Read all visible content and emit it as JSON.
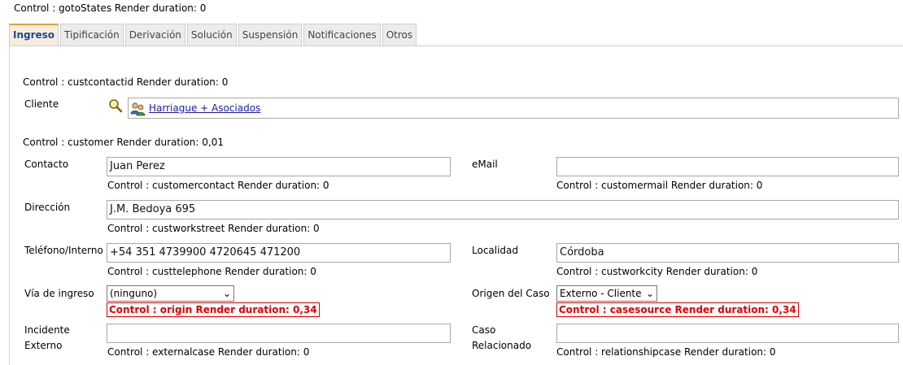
{
  "header": {
    "render_text": "Control : gotoStates Render duration: 0"
  },
  "tabs": [
    {
      "label": "Ingreso"
    },
    {
      "label": "Tipificación"
    },
    {
      "label": "Derivación"
    },
    {
      "label": "Solución"
    },
    {
      "label": "Suspensión"
    },
    {
      "label": "Notificaciones"
    },
    {
      "label": "Otros"
    }
  ],
  "form": {
    "custcontactid_render": "Control : custcontactid Render duration: 0",
    "cliente_label": "Cliente",
    "cliente_value": "Harriague + Asociados",
    "customer_render": "Control : customer Render duration: 0,01",
    "contacto_label": "Contacto",
    "contacto_value": "Juan Perez",
    "contacto_render": "Control : customercontact Render duration: 0",
    "email_label": "eMail",
    "email_value": "",
    "email_render": "Control : customermail Render duration: 0",
    "direccion_label": "Dirección",
    "direccion_value": "J.M. Bedoya 695",
    "direccion_render": "Control : custworkstreet Render duration: 0",
    "telefono_label": "Teléfono/Interno",
    "telefono_value": "+54 351 4739900 4720645 471200",
    "telefono_render": "Control : custtelephone Render duration: 0",
    "localidad_label": "Localidad",
    "localidad_value": "Córdoba",
    "localidad_render": "Control : custworkcity Render duration: 0",
    "via_label": "Vía de ingreso",
    "via_value": "(ninguno)",
    "via_render": "Control : origin Render duration: 0,34",
    "origen_label": "Origen del Caso",
    "origen_value": "Externo - Cliente",
    "origen_render": "Control : casesource Render duration: 0,34",
    "incidente_label_1": "Incidente",
    "incidente_label_2": "Externo",
    "incidente_value": "",
    "incidente_render": "Control : externalcase Render duration: 0",
    "caso_label_1": "Caso",
    "caso_label_2": "Relacionado",
    "caso_value": "",
    "caso_render": "Control : relationshipcase Render duration: 0"
  }
}
